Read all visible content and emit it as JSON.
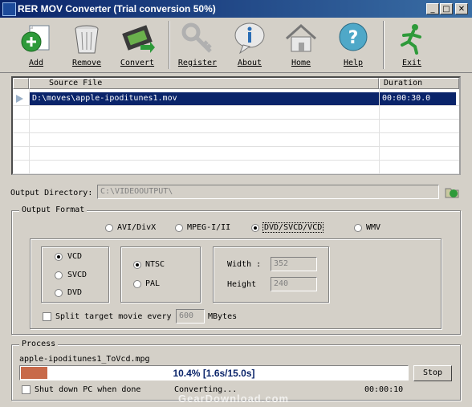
{
  "window": {
    "title": "RER MOV Converter (Trial conversion 50%)",
    "min": "_",
    "max": "□",
    "close": "✕"
  },
  "toolbar": {
    "add": "Add",
    "remove": "Remove",
    "convert": "Convert",
    "register": "Register",
    "about": "About",
    "home": "Home",
    "help": "Help",
    "exit": "Exit"
  },
  "file_list": {
    "columns": [
      "Source File",
      "Duration"
    ],
    "rows": [
      {
        "source": "D:\\moves\\apple-ipoditunes1.mov",
        "duration": "00:00:30.0"
      }
    ]
  },
  "output_dir": {
    "label": "Output Directory:",
    "value": "C:\\VIDEOOUTPUT\\"
  },
  "format": {
    "group_label": "Output Format",
    "options": [
      "AVI/DivX",
      "MPEG-I/II",
      "DVD/SVCD/VCD",
      "WMV"
    ],
    "selected": "DVD/SVCD/VCD",
    "disc_types": [
      "VCD",
      "SVCD",
      "DVD"
    ],
    "disc_selected": "VCD",
    "standards": [
      "NTSC",
      "PAL"
    ],
    "standard_selected": "NTSC",
    "width_label": "Width :",
    "width_value": "352",
    "height_label": "Height",
    "height_value": "240",
    "split_label": "Split target movie every",
    "split_value": "600",
    "split_unit": "MBytes",
    "split_checked": false
  },
  "process": {
    "group_label": "Process",
    "file": "apple-ipoditunes1_ToVcd.mpg",
    "progress_text": "10.4% [1.6s/15.0s]",
    "progress": 0.104,
    "stop_label": "Stop",
    "shutdown_label": "Shut down PC when done",
    "status": "Converting...",
    "elapsed": "00:00:10",
    "watermark": "GearDownload.com"
  }
}
